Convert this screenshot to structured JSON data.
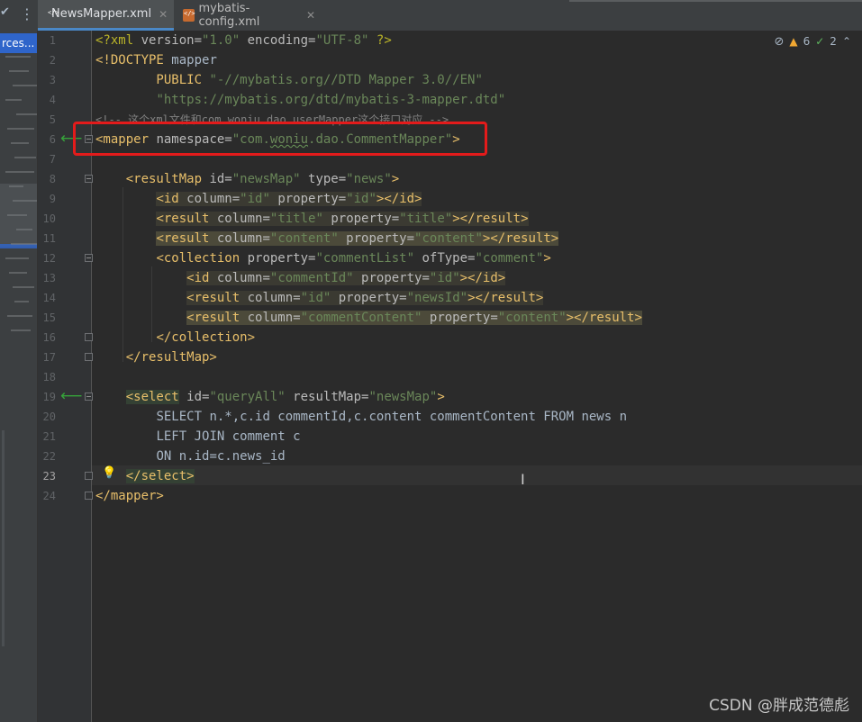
{
  "tabs": [
    {
      "label": "NewsMapper.xml",
      "active": true,
      "icon": "xml-file-icon"
    },
    {
      "label": "mybatis-config.xml",
      "active": false,
      "icon": "xml-file-icon"
    }
  ],
  "sidebar": {
    "selected_label": "rces..."
  },
  "inspection": {
    "warnings": "6",
    "ok": "2"
  },
  "line_numbers": [
    "1",
    "2",
    "3",
    "4",
    "5",
    "6",
    "7",
    "8",
    "9",
    "10",
    "11",
    "12",
    "13",
    "14",
    "15",
    "16",
    "17",
    "18",
    "19",
    "20",
    "21",
    "22",
    "23",
    "24"
  ],
  "code": {
    "l1_a": "<?xml ",
    "l1_b": "version=",
    "l1_c": "\"1.0\"",
    "l1_d": " encoding=",
    "l1_e": "\"UTF-8\"",
    "l1_f": " ?>",
    "l2_a": "<!DOCTYPE ",
    "l2_b": "mapper",
    "l3_a": "        PUBLIC ",
    "l3_b": "\"-//mybatis.org//DTD Mapper 3.0//EN\"",
    "l4_a": "        ",
    "l4_b": "\"https://mybatis.org/dtd/mybatis-3-mapper.dtd\"",
    "l5": "<!-- 这个xml文件和com.woniu.dao.userMapper这个接口对应 -->",
    "l6_a": "<mapper ",
    "l6_b": "namespace=",
    "l6_c": "\"com.",
    "l6_d": "woniu",
    "l6_e": ".dao.CommentMapper\"",
    "l6_f": ">",
    "l8_a": "<resultMap ",
    "l8_b": "id=",
    "l8_c": "\"newsMap\"",
    "l8_d": " type=",
    "l8_e": "\"news\"",
    "l8_f": ">",
    "l9_a": "<id ",
    "l9_b": "column=",
    "l9_c": "\"id\"",
    "l9_d": " property=",
    "l9_e": "\"id\"",
    "l9_f": "></id>",
    "l10_a": "<result ",
    "l10_b": "column=",
    "l10_c": "\"title\"",
    "l10_d": " property=",
    "l10_e": "\"title\"",
    "l10_f": "></result>",
    "l11_a": "<result ",
    "l11_b": "column=",
    "l11_c": "\"content\"",
    "l11_d": " property=",
    "l11_e": "\"content\"",
    "l11_f": "></result>",
    "l12_a": "<collection ",
    "l12_b": "property=",
    "l12_c": "\"commentList\"",
    "l12_d": " ofType=",
    "l12_e": "\"comment\"",
    "l12_f": ">",
    "l13_a": "<id ",
    "l13_b": "column=",
    "l13_c": "\"commentId\"",
    "l13_d": " property=",
    "l13_e": "\"id\"",
    "l13_f": "></id>",
    "l14_a": "<result ",
    "l14_b": "column=",
    "l14_c": "\"id\"",
    "l14_d": " property=",
    "l14_e": "\"newsId\"",
    "l14_f": "></result>",
    "l15_a": "<result ",
    "l15_b": "column=",
    "l15_c": "\"commentContent\"",
    "l15_d": " property=",
    "l15_e": "\"content\"",
    "l15_f": "></result>",
    "l16": "</collection>",
    "l17": "</resultMap>",
    "l19_a": "<select",
    "l19_b": " id=",
    "l19_c": "\"queryAll\"",
    "l19_d": " resultMap=",
    "l19_e": "\"newsMap\"",
    "l19_f": ">",
    "l20": "SELECT n.*,c.id commentId,c.content commentContent FROM news n",
    "l21": "LEFT JOIN comment c",
    "l22": "ON n.id=c.news_id",
    "l23": "</select>",
    "l24": "</mapper>"
  },
  "watermark": "CSDN @胖成范德彪"
}
